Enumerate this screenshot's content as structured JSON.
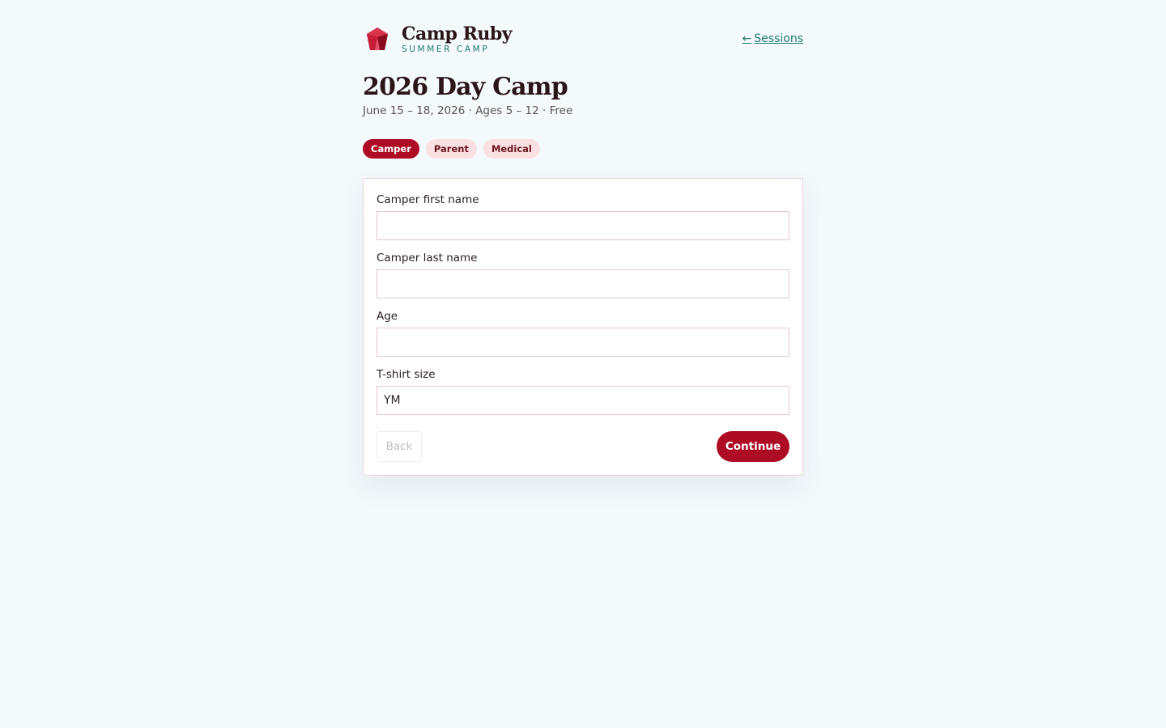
{
  "brand": {
    "name": "Camp Ruby",
    "subtitle": "SUMMER CAMP",
    "logo_icon": "ruby-gem-icon"
  },
  "nav": {
    "back_link_arrow": "←",
    "back_link_label": "Sessions"
  },
  "session": {
    "title": "2026 Day Camp",
    "meta": "June 15 – 18, 2026 · Ages 5 – 12 · Free"
  },
  "steps": [
    {
      "label": "Camper",
      "active": true
    },
    {
      "label": "Parent",
      "active": false
    },
    {
      "label": "Medical",
      "active": false
    }
  ],
  "form": {
    "fields": [
      {
        "label": "Camper first name",
        "value": "",
        "placeholder": ""
      },
      {
        "label": "Camper last name",
        "value": "",
        "placeholder": ""
      },
      {
        "label": "Age",
        "value": "",
        "placeholder": ""
      },
      {
        "label": "T-shirt size",
        "value": "YM",
        "placeholder": ""
      }
    ],
    "back_label": "Back",
    "continue_label": "Continue"
  },
  "colors": {
    "accent": "#ad0c24",
    "teal": "#1f7a6c",
    "background": "#f4f9fc",
    "pill_inactive_bg": "#fbe0e2"
  }
}
